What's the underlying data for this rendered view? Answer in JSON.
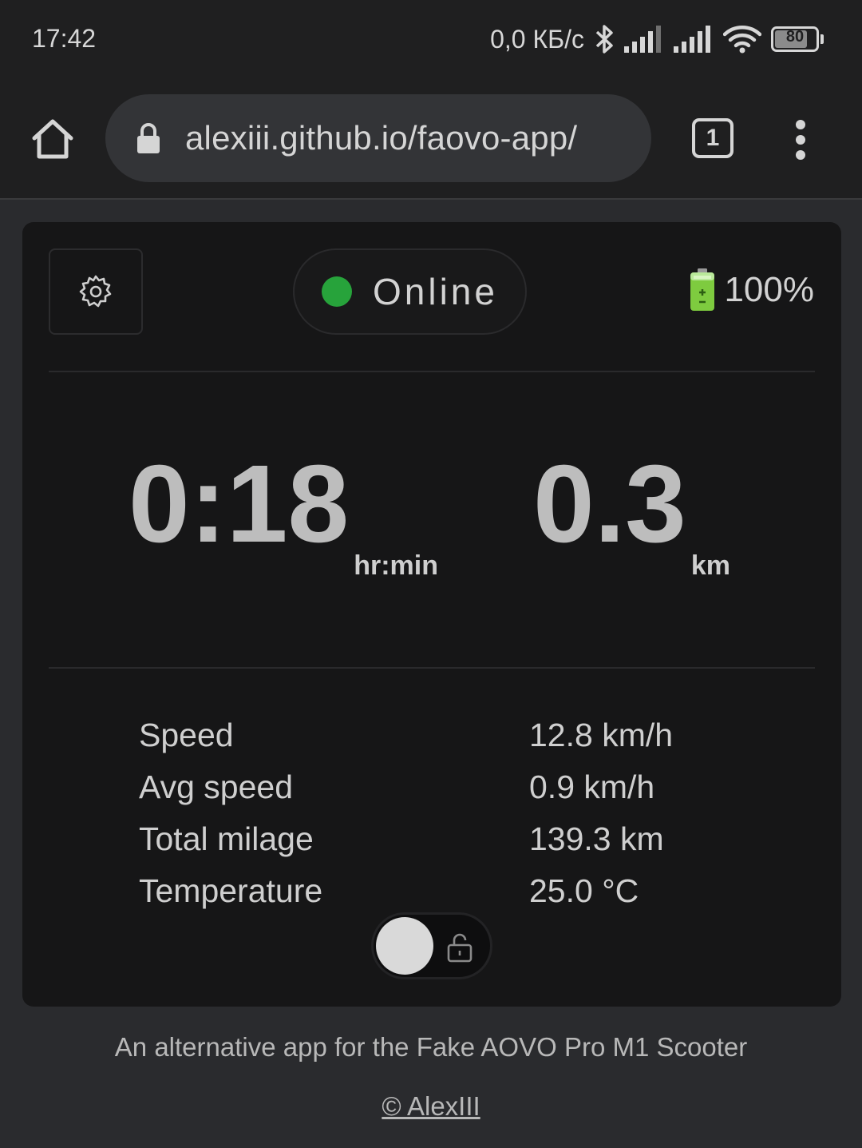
{
  "status_bar": {
    "time": "17:42",
    "network_speed": "0,0 КБ/с",
    "battery": "80",
    "icons": [
      "bluetooth-icon",
      "signal-icon",
      "signal-icon",
      "wifi-icon",
      "battery-icon"
    ]
  },
  "browser": {
    "url": "alexiii.github.io/faovo-app/",
    "tab_count": "1",
    "icons": [
      "home-icon",
      "lock-icon",
      "tabs-icon",
      "more-vert-icon"
    ]
  },
  "app": {
    "connection_status": "Online",
    "status_color": "#27a33b",
    "battery_level": "100%",
    "trip_time": {
      "value": "0:18",
      "unit": "hr:min"
    },
    "trip_distance": {
      "value": "0.3",
      "unit": "km"
    },
    "stats": [
      {
        "label": "Speed",
        "value": "12.8 km/h"
      },
      {
        "label": "Avg speed",
        "value": "0.9 km/h"
      },
      {
        "label": "Total milage",
        "value": "139.3 km"
      },
      {
        "label": "Temperature",
        "value": "25.0 °C"
      }
    ],
    "lock_toggle": {
      "state": "unlocked"
    }
  },
  "footer": {
    "description": "An alternative app for the Fake AOVO Pro M1 Scooter",
    "credit": "© AlexIII"
  }
}
